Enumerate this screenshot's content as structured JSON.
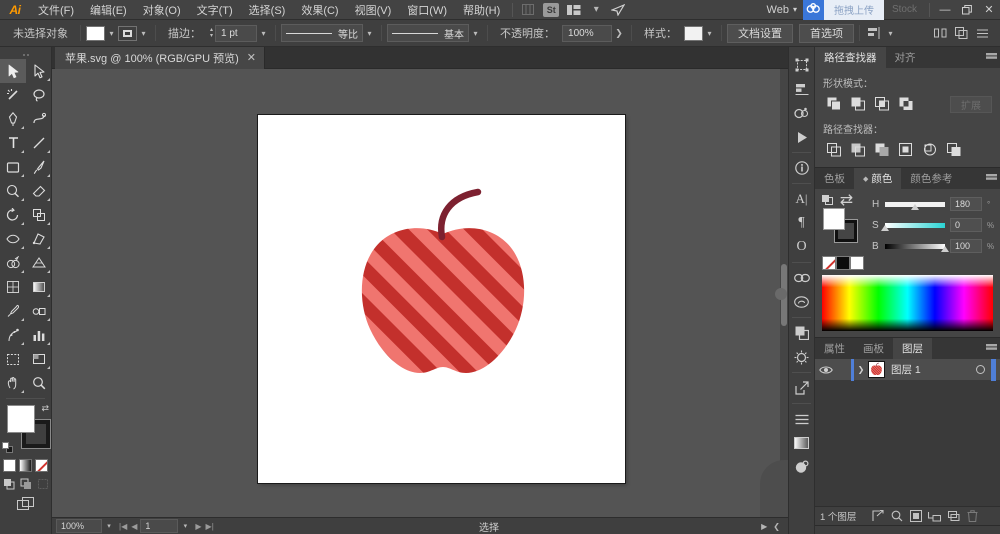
{
  "app": {
    "name": "Adobe Illustrator",
    "logo": "Ai"
  },
  "menubar": {
    "items": [
      {
        "label": "文件(F)",
        "name": "menu-file"
      },
      {
        "label": "编辑(E)",
        "name": "menu-edit"
      },
      {
        "label": "对象(O)",
        "name": "menu-object"
      },
      {
        "label": "文字(T)",
        "name": "menu-type"
      },
      {
        "label": "选择(S)",
        "name": "menu-select"
      },
      {
        "label": "效果(C)",
        "name": "menu-effect"
      },
      {
        "label": "视图(V)",
        "name": "menu-view"
      },
      {
        "label": "窗口(W)",
        "name": "menu-window"
      },
      {
        "label": "帮助(H)",
        "name": "menu-help"
      }
    ],
    "stock_icon_label": "St",
    "workspace": "Web",
    "upload_label": "拖拽上传",
    "stock_label": "Stock",
    "minimize": "—",
    "restore": "❐",
    "close": "✕"
  },
  "controlbar": {
    "selection_status": "未选择对象",
    "fill_color": "#ffffff",
    "stroke_label": "描边：",
    "stroke_width": "1 pt",
    "stroke_profile": "等比",
    "brush_definition": "基本",
    "opacity_label": "不透明度：",
    "opacity_value": "100%",
    "style_label": "样式：",
    "document_setup": "文档设置",
    "preferences": "首选项"
  },
  "tabbar": {
    "document_title": "苹果.svg @ 100% (RGB/GPU 预览)",
    "close_glyph": "✕"
  },
  "toolbar": {
    "tools": [
      {
        "name": "selection-tool",
        "glyph": "arrow-solid",
        "active": true
      },
      {
        "name": "direct-selection-tool",
        "glyph": "arrow-hollow",
        "corner": true
      },
      {
        "name": "magic-wand-tool",
        "glyph": "wand",
        "corner": false
      },
      {
        "name": "lasso-tool",
        "glyph": "lasso",
        "corner": false
      },
      {
        "name": "pen-tool",
        "glyph": "pen",
        "corner": true
      },
      {
        "name": "curvature-tool",
        "glyph": "curvature",
        "corner": false
      },
      {
        "name": "type-tool",
        "glyph": "type",
        "corner": true
      },
      {
        "name": "line-segment-tool",
        "glyph": "line",
        "corner": true
      },
      {
        "name": "rectangle-tool",
        "glyph": "rectangle",
        "corner": true
      },
      {
        "name": "paintbrush-tool",
        "glyph": "brush",
        "corner": true
      },
      {
        "name": "shaper-tool",
        "glyph": "shaper",
        "corner": true
      },
      {
        "name": "eraser-tool",
        "glyph": "eraser",
        "corner": true
      },
      {
        "name": "rotate-tool",
        "glyph": "rotate",
        "corner": true
      },
      {
        "name": "scale-tool",
        "glyph": "scale",
        "corner": true
      },
      {
        "name": "width-tool",
        "glyph": "width",
        "corner": true
      },
      {
        "name": "free-transform-tool",
        "glyph": "free-transform",
        "corner": false
      },
      {
        "name": "shape-builder-tool",
        "glyph": "shape-builder",
        "corner": true
      },
      {
        "name": "perspective-grid-tool",
        "glyph": "perspective",
        "corner": true
      },
      {
        "name": "mesh-tool",
        "glyph": "mesh",
        "corner": false
      },
      {
        "name": "gradient-tool",
        "glyph": "gradient",
        "corner": false
      },
      {
        "name": "eyedropper-tool",
        "glyph": "eyedropper",
        "corner": true
      },
      {
        "name": "blend-tool",
        "glyph": "blend",
        "corner": true
      },
      {
        "name": "symbol-sprayer-tool",
        "glyph": "symbol-sprayer",
        "corner": true
      },
      {
        "name": "column-graph-tool",
        "glyph": "graph",
        "corner": true
      },
      {
        "name": "artboard-tool",
        "glyph": "artboard",
        "corner": false
      },
      {
        "name": "slice-tool",
        "glyph": "slice",
        "corner": true
      },
      {
        "name": "hand-tool",
        "glyph": "hand",
        "corner": true
      },
      {
        "name": "zoom-tool",
        "glyph": "zoom",
        "corner": false
      }
    ],
    "fill_color": "#ffffff",
    "stroke_color": "#1a1a1a",
    "color_modes": [
      {
        "name": "fill-color-mode",
        "label": "color"
      },
      {
        "name": "gradient-mode",
        "label": "gradient"
      },
      {
        "name": "none-mode",
        "label": "none"
      }
    ],
    "draw_modes": [
      {
        "name": "draw-normal-mode"
      },
      {
        "name": "draw-behind-mode"
      },
      {
        "name": "draw-inside-mode"
      }
    ]
  },
  "canvas": {
    "artboard_bg": "#ffffff",
    "background": "#545454",
    "artwork": {
      "name": "striped-apple",
      "body_color_dark": "#c3302c",
      "body_color_light": "#f07b76",
      "stem_color": "#7d2130",
      "stripe_angle_deg": 45
    }
  },
  "statusbar": {
    "zoom_level": "100%",
    "page_number": "1",
    "status_text": "选择",
    "first_glyph": "|◀",
    "prev_glyph": "◀",
    "next_glyph": "▶",
    "last_glyph": "▶|"
  },
  "rail": {
    "icons": [
      {
        "name": "transform-panel-icon",
        "glyph": "transform"
      },
      {
        "name": "align-panel-icon",
        "glyph": "align"
      },
      {
        "name": "pathfinder-panel-icon",
        "glyph": "pathfinder"
      },
      {
        "name": "libraries-play-icon",
        "glyph": "play"
      },
      {
        "name": "info-panel-icon",
        "glyph": "info"
      },
      {
        "name": "character-panel-icon",
        "glyph": "character"
      },
      {
        "name": "paragraph-panel-icon",
        "glyph": "paragraph"
      },
      {
        "name": "opentype-panel-icon",
        "glyph": "opentype"
      },
      {
        "name": "links-panel-icon",
        "glyph": "links"
      },
      {
        "name": "creative-cloud-icon",
        "glyph": "cc"
      },
      {
        "name": "transparency-panel-icon",
        "glyph": "transparency"
      },
      {
        "name": "appearance-panel-icon",
        "glyph": "appearance"
      },
      {
        "name": "export-panel-icon",
        "glyph": "export"
      },
      {
        "name": "document-info-icon",
        "glyph": "docinfo"
      },
      {
        "name": "gradient-panel-icon",
        "glyph": "gradient"
      },
      {
        "name": "symbols-panel-icon",
        "glyph": "symbols"
      }
    ]
  },
  "panels": {
    "pathfinder": {
      "tabs": [
        {
          "label": "路径查找器",
          "active": true,
          "name": "tab-pathfinder"
        },
        {
          "label": "对齐",
          "active": false,
          "name": "tab-align"
        }
      ],
      "shape_modes_label": "形状模式：",
      "shape_modes": [
        {
          "name": "unite-button"
        },
        {
          "name": "minus-front-button"
        },
        {
          "name": "intersect-button"
        },
        {
          "name": "exclude-button"
        }
      ],
      "expand_label": "扩展",
      "pathfinders_label": "路径查找器：",
      "pathfinders": [
        {
          "name": "divide-button"
        },
        {
          "name": "trim-button"
        },
        {
          "name": "merge-button"
        },
        {
          "name": "crop-button"
        },
        {
          "name": "outline-button"
        },
        {
          "name": "minus-back-button"
        }
      ]
    },
    "color": {
      "tabs": [
        {
          "label": "色板",
          "active": false,
          "name": "tab-swatches"
        },
        {
          "label": "颜色",
          "active": true,
          "name": "tab-color"
        },
        {
          "label": "颜色参考",
          "active": false,
          "name": "tab-color-guide"
        }
      ],
      "fill_color": "#ffffff",
      "stroke_color": "#101010",
      "sliders": [
        {
          "label": "H",
          "value": "180",
          "unit": "°",
          "pct": 50,
          "name": "hue-slider"
        },
        {
          "label": "S",
          "value": "0",
          "unit": "%",
          "pct": 0,
          "name": "saturation-slider"
        },
        {
          "label": "B",
          "value": "100",
          "unit": "%",
          "pct": 100,
          "name": "brightness-slider"
        }
      ],
      "quick_swatches": [
        {
          "name": "none-swatch",
          "color": "none"
        },
        {
          "name": "black-swatch",
          "color": "#0d0d0d"
        },
        {
          "name": "white-swatch",
          "color": "#ffffff"
        }
      ]
    },
    "layers": {
      "tabs": [
        {
          "label": "属性",
          "active": false,
          "name": "tab-properties"
        },
        {
          "label": "画板",
          "active": false,
          "name": "tab-artboards"
        },
        {
          "label": "图层",
          "active": true,
          "name": "tab-layers"
        }
      ],
      "rows": [
        {
          "name": "图层 1",
          "visible": true,
          "selected": true,
          "color": "#4f7fd8",
          "eye_glyph": "◉",
          "chevron_glyph": "❯"
        }
      ],
      "footer_count": "1 个图层",
      "footer_buttons": [
        {
          "name": "locate-object-button"
        },
        {
          "name": "search-layer-button"
        },
        {
          "name": "make-clipping-mask-button"
        },
        {
          "name": "create-sublayer-button"
        },
        {
          "name": "create-new-layer-button"
        },
        {
          "name": "delete-layer-button"
        }
      ]
    }
  }
}
